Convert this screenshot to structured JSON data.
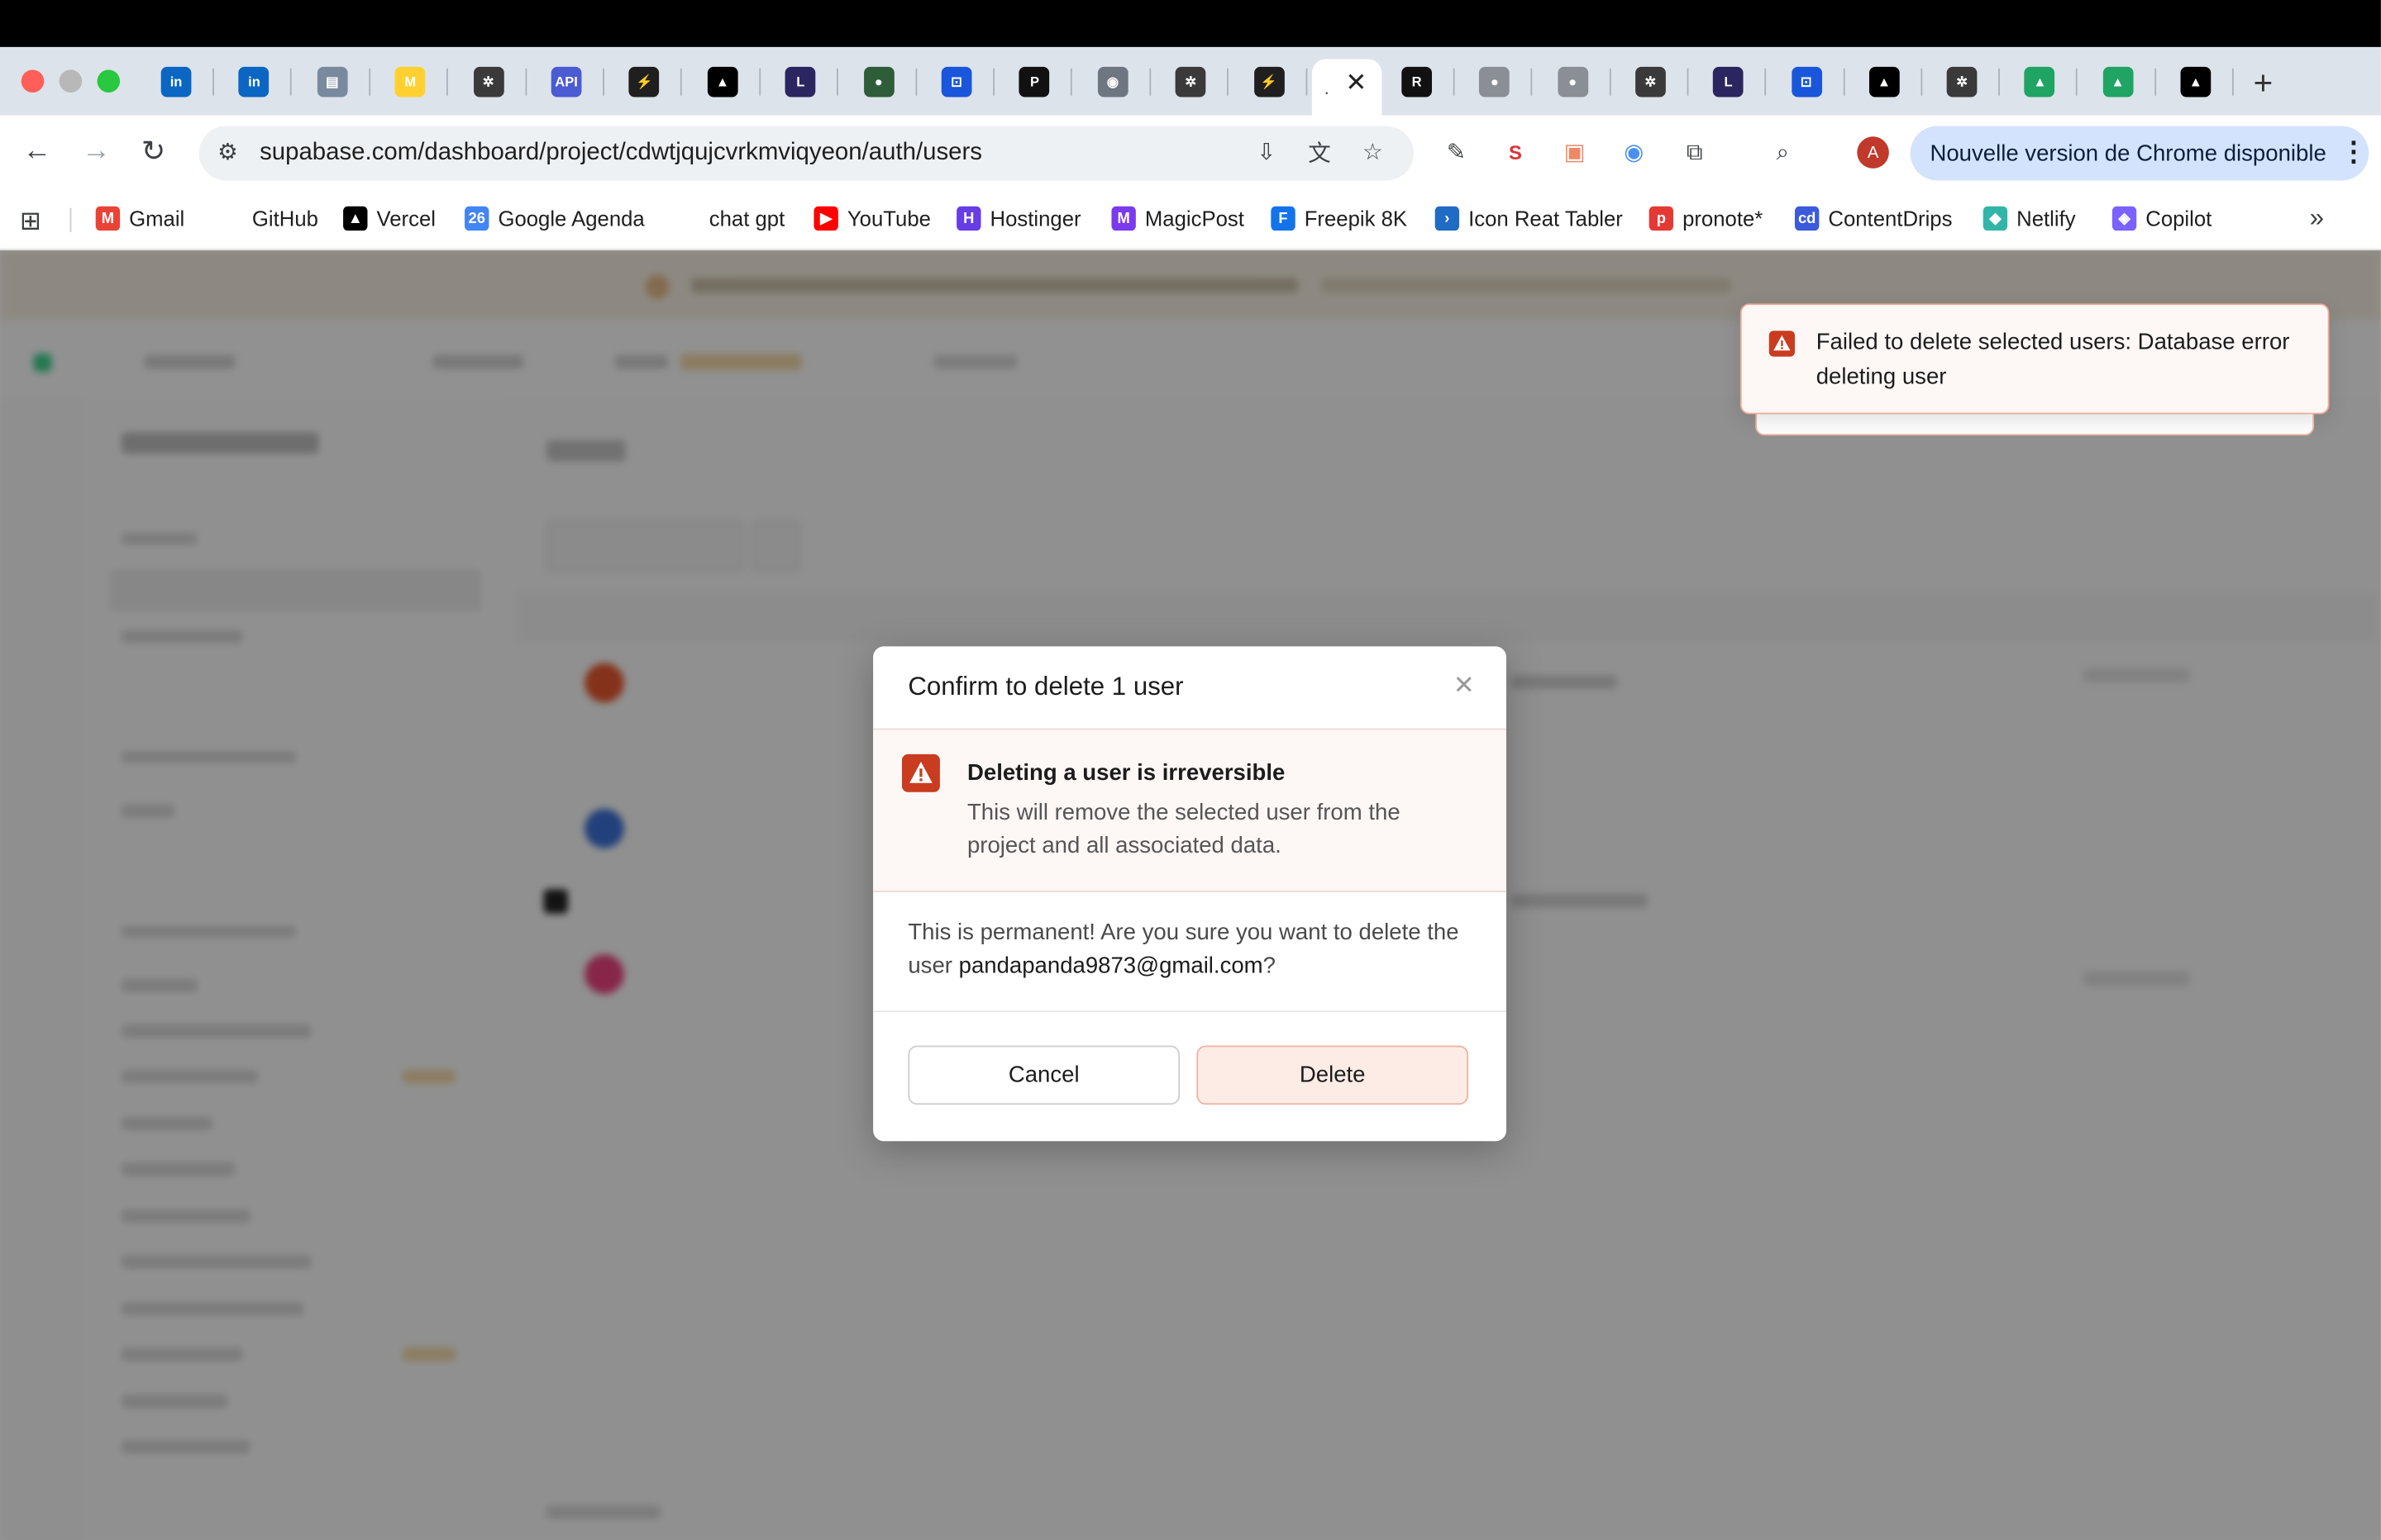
{
  "browser": {
    "url": "supabase.com/dashboard/project/cdwtjqujcvrkmviqyeon/auth/users",
    "update_label": "Nouvelle version de Chrome disponible",
    "tabs": [
      {
        "icon": "linkedin-icon",
        "color": "#0a66c2",
        "glyph": "in"
      },
      {
        "icon": "linkedin-icon",
        "color": "#0a66c2",
        "glyph": "in"
      },
      {
        "icon": "clipboard-icon",
        "color": "#7a8a9e",
        "glyph": "▤"
      },
      {
        "icon": "miro-icon",
        "color": "#ffd02f",
        "glyph": "M"
      },
      {
        "icon": "openai-icon",
        "color": "#3a3a3a",
        "glyph": "✲"
      },
      {
        "icon": "api-icon",
        "color": "#4a5bd4",
        "glyph": "API"
      },
      {
        "icon": "supabase-icon",
        "color": "#1f1f1f",
        "glyph": "⚡"
      },
      {
        "icon": "vercel-icon",
        "color": "#000000",
        "glyph": "▲"
      },
      {
        "icon": "lynxlet-icon",
        "color": "#2b2660",
        "glyph": "L"
      },
      {
        "icon": "globe-icon",
        "color": "#2f5d3a",
        "glyph": "●"
      },
      {
        "icon": "toolbox-icon",
        "color": "#1a56db",
        "glyph": "⊡"
      },
      {
        "icon": "p-icon",
        "color": "#111111",
        "glyph": "P"
      },
      {
        "icon": "github-icon",
        "color": "#6e7681",
        "glyph": "◉"
      },
      {
        "icon": "openai-icon",
        "color": "#3a3a3a",
        "glyph": "✲"
      },
      {
        "icon": "supabase-icon",
        "color": "#1f1f1f",
        "glyph": "⚡"
      }
    ],
    "tabs_right": [
      {
        "icon": "r-icon",
        "color": "#111111",
        "glyph": "R"
      },
      {
        "icon": "globe-icon",
        "color": "#8a8f96",
        "glyph": "●"
      },
      {
        "icon": "globe-icon",
        "color": "#8a8f96",
        "glyph": "●"
      },
      {
        "icon": "openai-icon",
        "color": "#3a3a3a",
        "glyph": "✲"
      },
      {
        "icon": "lynxlet-icon",
        "color": "#2b2660",
        "glyph": "L"
      },
      {
        "icon": "toolbox-icon",
        "color": "#1a56db",
        "glyph": "⊡"
      },
      {
        "icon": "vercel-icon",
        "color": "#000000",
        "glyph": "▲"
      },
      {
        "icon": "openai-icon",
        "color": "#3a3a3a",
        "glyph": "✲"
      },
      {
        "icon": "drive-icon",
        "color": "#1fa463",
        "glyph": "▲"
      },
      {
        "icon": "drive-icon",
        "color": "#1fa463",
        "glyph": "▲"
      },
      {
        "icon": "vercel-icon",
        "color": "#000000",
        "glyph": "▲"
      }
    ]
  },
  "bookmarks": [
    {
      "label": "Gmail",
      "icon": "gmail-icon",
      "color": "#ea4335",
      "glyph": "M"
    },
    {
      "label": "GitHub",
      "icon": "github-icon",
      "color": "#ffffff",
      "glyph": ""
    },
    {
      "label": "Vercel",
      "icon": "vercel-icon",
      "color": "#000000",
      "glyph": "▲"
    },
    {
      "label": "Google Agenda",
      "icon": "calendar-icon",
      "color": "#4285f4",
      "glyph": "26"
    },
    {
      "label": "chat gpt",
      "icon": "chatgpt-icon",
      "color": "#ffffff",
      "glyph": ""
    },
    {
      "label": "YouTube",
      "icon": "youtube-icon",
      "color": "#ff0000",
      "glyph": "▶"
    },
    {
      "label": "Hostinger",
      "icon": "hostinger-icon",
      "color": "#673de6",
      "glyph": "H"
    },
    {
      "label": "MagicPost",
      "icon": "magicpost-icon",
      "color": "#7c3aed",
      "glyph": "M"
    },
    {
      "label": "Freepik 8K",
      "icon": "freepik-icon",
      "color": "#1273eb",
      "glyph": "F"
    },
    {
      "label": "Icon Reat Tabler",
      "icon": "tabler-icon",
      "color": "#206bc4",
      "glyph": "›"
    },
    {
      "label": "pronote*",
      "icon": "pronote-icon",
      "color": "#e53935",
      "glyph": "p"
    },
    {
      "label": "ContentDrips",
      "icon": "contentdrips-icon",
      "color": "#3b5bdb",
      "glyph": "cd"
    },
    {
      "label": "Netlify",
      "icon": "netlify-icon",
      "color": "#32b5a8",
      "glyph": "◆"
    },
    {
      "label": "Copilot",
      "icon": "copilot-icon",
      "color": "#7b61ff",
      "glyph": "◈"
    }
  ],
  "modal": {
    "title": "Confirm to delete 1 user",
    "warning_title": "Deleting a user is irreversible",
    "warning_body": "This will remove the selected user from the project and all associated data.",
    "confirm_prefix": "This is permanent! Are you sure you want to delete the user ",
    "confirm_email": "pandapanda9873@gmail.com",
    "confirm_suffix": "?",
    "cancel_label": "Cancel",
    "delete_label": "Delete"
  },
  "toast": {
    "message": "Failed to delete selected users: Database error deleting user"
  }
}
